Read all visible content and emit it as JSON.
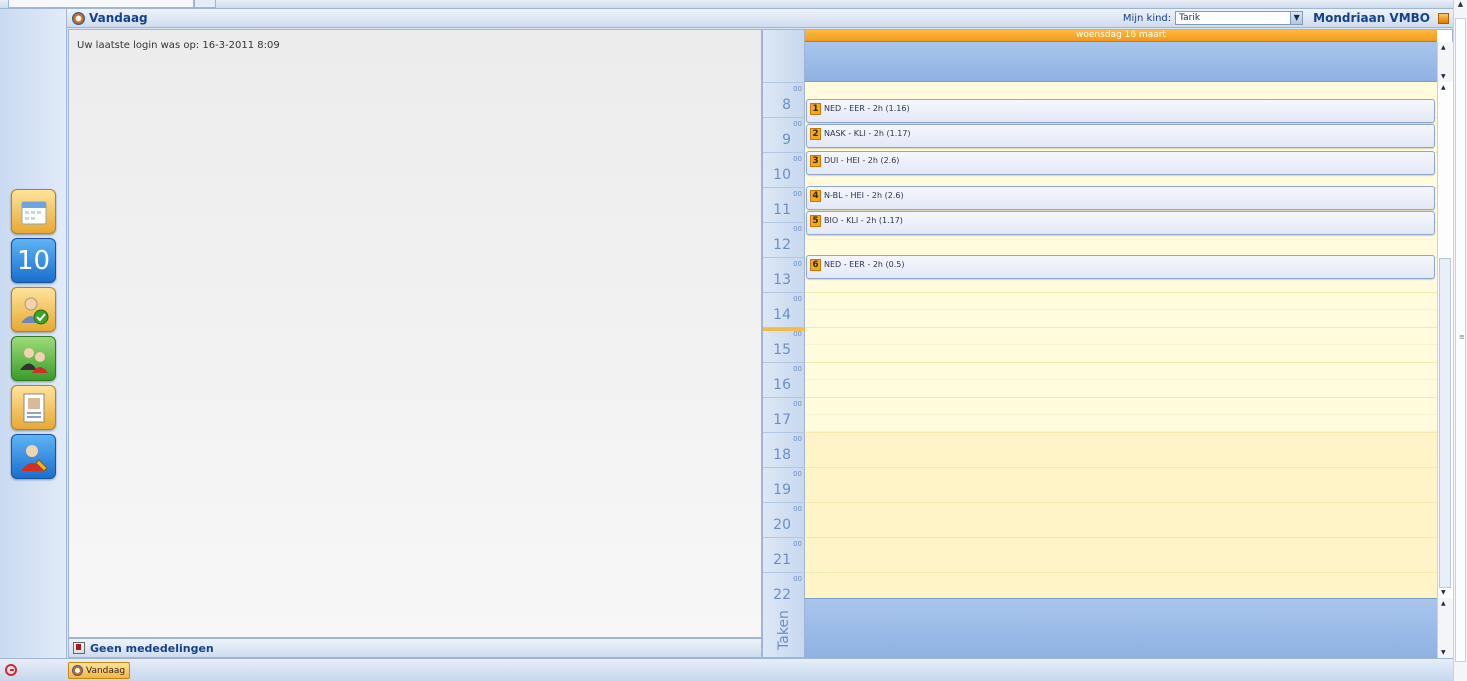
{
  "header": {
    "title": "Vandaag",
    "kid_label": "Mijn kind:",
    "kid_selected": "Tarik",
    "school": "Mondriaan VMBO"
  },
  "login": {
    "message": "Uw laatste login was op: 16-3-2011 8:09"
  },
  "mededelingen": {
    "label": "Geen mededelingen"
  },
  "sidebar": {
    "items": [
      {
        "icon": "calendar-icon",
        "color": "gold"
      },
      {
        "icon": "grades-icon",
        "label": "10",
        "color": "blue"
      },
      {
        "icon": "attendance-check-icon",
        "color": "gold"
      },
      {
        "icon": "people-group-icon",
        "color": "green"
      },
      {
        "icon": "id-card-icon",
        "color": "gold"
      },
      {
        "icon": "student-profile-icon",
        "color": "blue"
      }
    ]
  },
  "calendar": {
    "day_header": "woensdag 16 maart",
    "hours": [
      {
        "h": "8",
        "m": "00"
      },
      {
        "h": "9",
        "m": "00"
      },
      {
        "h": "10",
        "m": "00"
      },
      {
        "h": "11",
        "m": "00"
      },
      {
        "h": "12",
        "m": "00"
      },
      {
        "h": "13",
        "m": "00"
      },
      {
        "h": "14",
        "m": "00"
      },
      {
        "h": "15",
        "m": "00"
      },
      {
        "h": "16",
        "m": "00"
      },
      {
        "h": "17",
        "m": "00"
      },
      {
        "h": "18",
        "m": "00"
      },
      {
        "h": "19",
        "m": "00"
      },
      {
        "h": "20",
        "m": "00"
      },
      {
        "h": "21",
        "m": "00"
      },
      {
        "h": "22",
        "m": "00"
      }
    ],
    "events": [
      {
        "num": "1",
        "text": "NED - EER - 2h  (1.16)"
      },
      {
        "num": "2",
        "text": "NASK - KLI - 2h  (1.17)"
      },
      {
        "num": "3",
        "text": "DUI - HEI - 2h  (2.6)"
      },
      {
        "num": "4",
        "text": "N-BL - HEI - 2h  (2.6)"
      },
      {
        "num": "5",
        "text": "BIO - KLI - 2h  (1.17)"
      },
      {
        "num": "6",
        "text": "NED - EER - 2h  (0.5)"
      }
    ],
    "taken_label": "Taken"
  },
  "taskbar": {
    "button_label": "Vandaag"
  },
  "colors": {
    "accent_orange": "#f19a1c",
    "header_blue": "#15428b",
    "grid_yellow": "#fffbdc"
  }
}
